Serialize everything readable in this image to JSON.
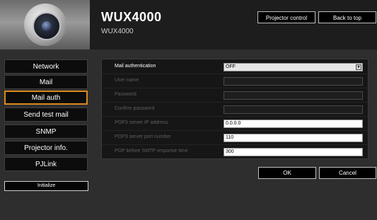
{
  "header": {
    "title": "WUX4000",
    "subtitle": "WUX4000",
    "projector_control_label": "Projector control",
    "back_to_top_label": "Back to top"
  },
  "sidebar": {
    "items": [
      {
        "label": "Network",
        "active": false
      },
      {
        "label": "Mail",
        "active": false
      },
      {
        "label": "Mail auth",
        "active": true
      },
      {
        "label": "Send test mail",
        "active": false
      },
      {
        "label": "SNMP",
        "active": false
      },
      {
        "label": "Projector info.",
        "active": false
      },
      {
        "label": "PJLink",
        "active": false
      }
    ],
    "initialize_label": "Initialize"
  },
  "form": {
    "mail_authentication": {
      "label": "Mail authentication",
      "value": "OFF"
    },
    "user_name": {
      "label": "User name",
      "value": ""
    },
    "password": {
      "label": "Password",
      "value": ""
    },
    "confirm_password": {
      "label": "Confirm password",
      "value": ""
    },
    "pop3_ip": {
      "label": "POP3 server IP address",
      "value": "0.0.0.0"
    },
    "pop3_port": {
      "label": "POP3 server port number",
      "value": "110"
    },
    "pop_smtp_time": {
      "label": "POP before SMTP response time",
      "value": "300"
    }
  },
  "actions": {
    "ok_label": "OK",
    "cancel_label": "Cancel"
  },
  "colors": {
    "background": "#2e2e2e",
    "active_border": "#d98a1e",
    "button_bg": "#000000"
  }
}
